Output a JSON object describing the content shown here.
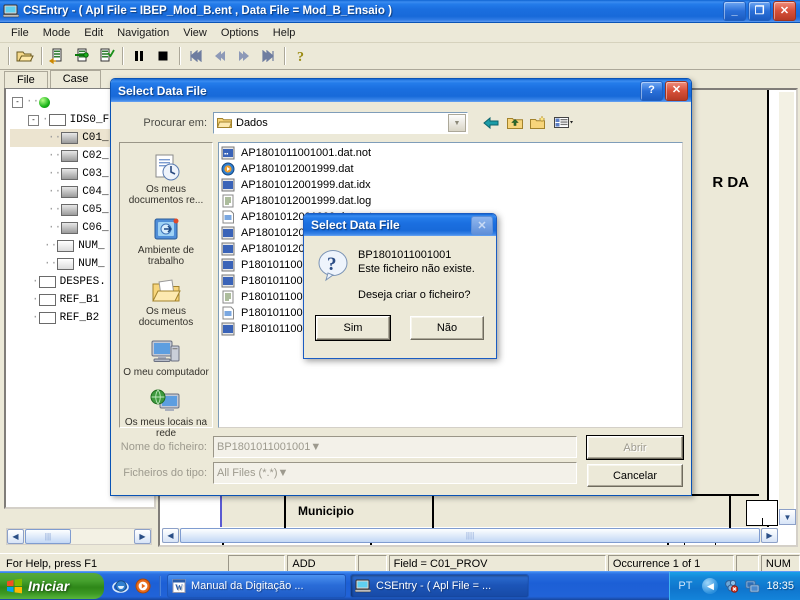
{
  "app": {
    "title": "CSEntry - ( Apl File = IBEP_Mod_B.ent , Data File = Mod_B_Ensaio )",
    "menu": [
      "File",
      "Mode",
      "Edit",
      "Navigation",
      "View",
      "Options",
      "Help"
    ],
    "window_buttons": {
      "minimize": "_",
      "restore": "❐",
      "close": "✕"
    },
    "toolbar": [
      {
        "name": "open-file-icon",
        "tip": "Open"
      },
      {
        "name": "add-case-icon",
        "tip": "Add"
      },
      {
        "name": "modify-case-icon",
        "tip": "Modify"
      },
      {
        "name": "verify-case-icon",
        "tip": "Verify"
      },
      {
        "name": "pause-icon",
        "tip": "Pause"
      },
      {
        "name": "stop-icon",
        "tip": "Stop"
      },
      {
        "name": "first-icon",
        "tip": "First"
      },
      {
        "name": "previous-icon",
        "tip": "Previous"
      },
      {
        "name": "next-icon",
        "tip": "Next"
      },
      {
        "name": "last-icon",
        "tip": "Last"
      },
      {
        "name": "help-icon",
        "tip": "Help"
      }
    ]
  },
  "tree_panel": {
    "tabs": [
      {
        "label": "File",
        "active": false
      },
      {
        "label": "Case",
        "active": true
      }
    ],
    "items": [
      {
        "label": "IDS0_F",
        "level": 1,
        "kind": "group",
        "expander": "-"
      },
      {
        "label": "C01_",
        "level": 2,
        "kind": "grey",
        "selected": true
      },
      {
        "label": "C02_",
        "level": 2,
        "kind": "grey"
      },
      {
        "label": "C03_",
        "level": 2,
        "kind": "grey"
      },
      {
        "label": "C04_",
        "level": 2,
        "kind": "grey"
      },
      {
        "label": "C05_",
        "level": 2,
        "kind": "grey"
      },
      {
        "label": "C06_",
        "level": 2,
        "kind": "grey"
      },
      {
        "label": "NUM_",
        "level": 2,
        "kind": "white"
      },
      {
        "label": "NUM_",
        "level": 2,
        "kind": "white"
      },
      {
        "label": "DESPES.",
        "level": 1,
        "kind": "blank"
      },
      {
        "label": "REF_B1",
        "level": 1,
        "kind": "blank"
      },
      {
        "label": "REF_B2",
        "level": 1,
        "kind": "blank"
      }
    ]
  },
  "form_panel": {
    "heading_fragment": "R DA",
    "municipio_label": "Municipio"
  },
  "dialog": {
    "title": "Select Data File",
    "help_button": "?",
    "close_button": "✕",
    "look_in_label": "Procurar em:",
    "look_in_value": "Dados",
    "toolbar_icons": [
      "back-icon",
      "up-one-level-icon",
      "new-folder-icon",
      "views-icon"
    ],
    "places": [
      {
        "label": "Os meus documentos re...",
        "icon": "recent-documents-icon"
      },
      {
        "label": "Ambiente de trabalho",
        "icon": "desktop-icon"
      },
      {
        "label": "Os meus documentos",
        "icon": "my-documents-icon"
      },
      {
        "label": "O meu computador",
        "icon": "my-computer-icon"
      },
      {
        "label": "Os meus locais na rede",
        "icon": "network-places-icon"
      }
    ],
    "files": [
      {
        "name": "AP1801011001001.dat.not",
        "icon": "dat-file-icon"
      },
      {
        "name": "AP1801012001999.dat",
        "icon": "media-file-icon"
      },
      {
        "name": "AP1801012001999.dat.idx",
        "icon": "dat-file-icon"
      },
      {
        "name": "AP1801012001999.dat.log",
        "icon": "log-file-icon"
      },
      {
        "name": "AP1801012001999.dat.not",
        "icon": "not-file-icon"
      },
      {
        "name": "AP1801012001999.dat.idx",
        "icon": "dat-file-icon"
      },
      {
        "name": "AP1801012001999.dat",
        "icon": "dat-file-icon"
      },
      {
        "name": "P1801011001001.dat",
        "icon": "dat-file-icon"
      },
      {
        "name": "P1801011001001.dat.idx",
        "icon": "dat-file-icon"
      },
      {
        "name": "P1801011001001.dat.log",
        "icon": "log-file-icon"
      },
      {
        "name": "P1801011001001.dat.not",
        "icon": "not-file-icon"
      },
      {
        "name": "P1801011001001.dat",
        "icon": "dat-file-icon"
      }
    ],
    "file_name_label": "Nome do ficheiro:",
    "file_name_value": "BP1801011001001",
    "file_type_label": "Ficheiros do tipo:",
    "file_type_value": "All Files  (*.*)",
    "open_button": "Abrir",
    "cancel_button": "Cancelar"
  },
  "messagebox": {
    "title": "Select Data File",
    "close_button": "✕",
    "icon": "question-icon",
    "line1": "BP1801011001001",
    "line2": "Este ficheiro não existe.",
    "line3": "Deseja criar o ficheiro?",
    "yes_button": "Sim",
    "no_button": "Não"
  },
  "statusbar": {
    "help_text": "For Help, press F1",
    "mode": "ADD",
    "field": "Field = C01_PROV",
    "occurrence": "Occurrence 1 of 1",
    "num_lock": "NUM"
  },
  "taskbar": {
    "start_label": "Iniciar",
    "quick_launch": [
      "ie-icon",
      "media-player-icon"
    ],
    "items": [
      {
        "label": "Manual da Digitação ...",
        "icon": "word-doc-icon"
      },
      {
        "label": "CSEntry - ( Apl File = ...",
        "icon": "csentry-icon"
      }
    ],
    "language": "PT",
    "clock": "18:35"
  },
  "colors": {
    "title_blue": "#1b6fe0",
    "face": "#ece9d8",
    "desktop": "#5a7edc",
    "start_green": "#3d9a25"
  }
}
